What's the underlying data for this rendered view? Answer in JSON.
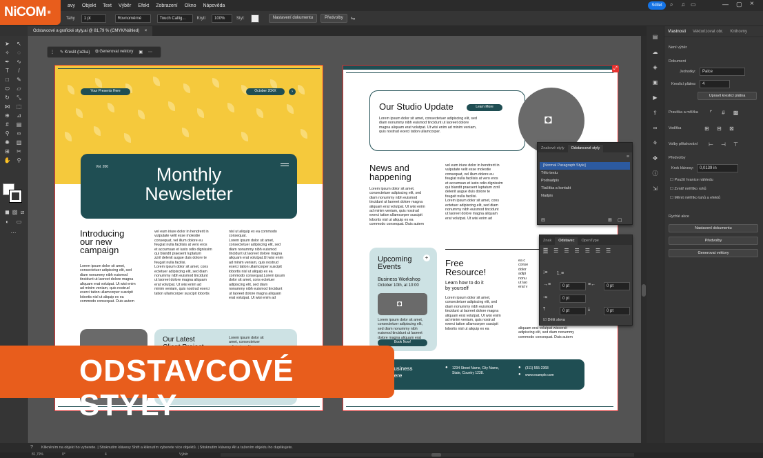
{
  "menu": [
    "avy",
    "Objekt",
    "Text",
    "Výběr",
    "Efekt",
    "Zobrazení",
    "Okno",
    "Nápověda"
  ],
  "share_label": "Sdílet",
  "logo": {
    "text": "NiCOM",
    "sub": ""
  },
  "control": {
    "stroke_label": "Tahy",
    "stroke_value": "1 pt",
    "profile": "Rovnoměrné",
    "brush": "Touch Callig...",
    "opacity_label": "Krytí",
    "opacity_value": "100%",
    "style_label": "Styl:",
    "doc_settings": "Nastavení dokumentu",
    "prefs": "Předvolby"
  },
  "tab": {
    "title": "Odstavcové a grafické styly.ai @ 81,79 % (CMYK/Náhled)",
    "close": "×"
  },
  "context": {
    "draw": "Kreslit (tužka)",
    "generate": "Generovat vektory"
  },
  "properties": {
    "tabs": [
      "Vlastnosti",
      "Vektorizovat obr.",
      "Knihovny"
    ],
    "no_selection": "Není výběr",
    "document": "Dokument",
    "units_label": "Jednotky:",
    "units_value": "Palce",
    "artboard_label": "Kreslicí plátno:",
    "artboard_value": "4",
    "edit_artboards": "Upravit kreslicí plátna",
    "rulers": "Pravítka a mřížka",
    "guides": "Vodítka",
    "snap": "Volby přitahování",
    "preferences": "Předvolby",
    "key_inc_label": "Krok klávesy:",
    "key_inc_value": "0,0139 in",
    "cb1": "Použít hranice náhledu",
    "cb2": "Zvnitř měřítko rohů",
    "cb3": "Měnit měřítko tahů a efektů",
    "quick": "Rychlé akce",
    "qa1": "Nastavení dokumentu",
    "qa2": "Předvolby",
    "qa3": "Generovat vektory"
  },
  "paragraph_styles": {
    "tabs": [
      "Znakové styly",
      "Odstavcové styly"
    ],
    "items": [
      "[Normal Paragraph Style]",
      "Tělo textu",
      "Podnadpis",
      "Tlačítka a kontakt",
      "Nadpis"
    ]
  },
  "paragraph_panel": {
    "tabs": [
      "Znak",
      "Odstavec",
      "OpenType"
    ],
    "f1": "0 pt",
    "f2": "0 pt",
    "f3": "0 pt",
    "f4": "0 pt",
    "f5": "0 pt",
    "f6": "0 pt",
    "hyphen": "Dělit slova"
  },
  "page1": {
    "presents": "Your Presents Here",
    "date": "October 20XX",
    "vol": "Vol. 200",
    "title1": "Monthly",
    "title2": "Newsletter",
    "intro": "Introducing\nour new\ncampaign",
    "c1": "Lorem ipsum dolor sit amet,\nconsectetuer adipiscing elit, sed\ndiam nonummy nibh euismod\ntincidunt ut laoreet dolore magna\naliquam erat volutpat. Ut wisi enim\nad minim veniam, quis nostrud\nexerci tation ullamcorper suscipit\nlobortis nisl ut aliquip ex ea\ncommodo consequat. Duis autem",
    "c2": "vel eum iriure dolor in hendrerit in\nvulputate velit esse molestie\nconsequat, vel illum dolore eu\nfeugiat nulla facilisis at vero eros\net accumsan et iusto odio dignissim\nqui blandit praesent luptatum\nzzril delenit augue duis dolore te\nfeugait nulla facilisi.\nLorem ipsum dolor sit amet, cons\nectetuer adipiscing elit, sed diam\nnonummy nibh euismod tincidunt\nut laoreet dolore magna aliquam\nerat volutpat. Ut wisi enim ad\nminim veniam, quis nostrud exerci\ntation ullamcorper suscipit lobortis",
    "c3": "nisl ut aliquip ex ea commodo\nconsequat.\nLorem ipsum dolor sit amet,\nconsectetuer adipiscing elit, sed\ndiam nonummy nibh euismod\ntincidunt ut laoreet dolore magna\naliquam erat volutpat.Ut wisi enim\nad minim veniam, quis nostrud\nexerci tation ullamcorper suscipit\nlobortis nisl ut aliquip ex ea\ncommodo consequat.Lorem ipsum\ndolor sit amet, cons ectetuer\nadipiscing elit, sed diam\nnonummy nibh euismod tincidunt\nut laoreet dolore magna aliquam\nerat volutpat. Ut wisi enim ad",
    "latest": "Our Latest\nClient Project",
    "c4": "Lorem ipsum dolor sit\namet, consectetuer\nadipiscing elit"
  },
  "page2": {
    "studio": "Our Studio Update",
    "learn": "Learn More",
    "studio_txt": "Lorem ipsum dolor sit amet, consectetuer adipiscing elit, sed\ndiam nonummy nibh euismod tincidunt ut laoreet dolore\nmagna aliquam erat volutpat. Ut wisi enim ad minim veniam,\nquis nostrud exerci tation ullamcorper.",
    "news": "News and\nhappening",
    "n1": "Lorem ipsum dolor sit amet,\nconsectetuer adipiscing elit, sed\ndiam nonummy nibh euismod\ntincidunt ut laoreet dolore magna\naliquam erat volutpat. Ut wisi enim\nad minim veniam, quis nostrud\nexerci tation ullamcorper suscipit\nlobortis nisl ut aliquip ex ea\ncommodo consequat. Duis autem",
    "n2": "vel eum iriure dolor in hendrerit in\nvulputate velit esse molestie\nconsequat, vel illum dolore eu\nfeugiat nulla facilisis at vero eros\net accumsan et iusto odio dignissim\nqui blandit praesent luptatum zzril\ndelenit augue duis dolore te\nfeugait nulla facilisi.\nLorem ipsum dolor sit amet, cons\nectetuer adipiscing elit, sed diam\nnonummy nibh euismod tincidunt\nut laoreet dolore magna aliquam\nerat volutpat. Ut wisi enim ad",
    "upcoming": "Upcoming\nEvents",
    "workshop": "Business Workshop",
    "wdate": "October 10th, at 10:00",
    "u_txt": "Lorem ipsum dolor sit amet,\nconsectetuer adipiscing elit,\nsed diam nonummy nibh\neuismod tincidunt ut laoreet\ndolore magna aliquam erat\nvolutpat.",
    "book": "Book Now!",
    "free": "Free\nResource!",
    "howto": "Learn how to do it\nby yourself",
    "f_txt": "Lorem ipsum dolor sit amet,\nconsectetuer adipiscing elit, sed\ndiam nonummy nibh euismod\ntincidunt ut laoreet dolore magna\naliquam erat volutpat. Ut wisi enim\nad minim veniam, quis nostrud\nexerci tation ullamcorper suscipit\nlobortis nisl ut aliquip ex ea",
    "f_txt2": "ea c\nconse\ndolor\nadipi\nnonu\nut lao\nerat v",
    "f_txt3": "aliquam erat volutpat wissersit\nadipiscing elit, sed diam nonummy\ncommodo consequat. Duis autem",
    "business": "Business\nHere",
    "address": "1234 Street Name, City Name,\nState, Country 1238.",
    "phone": "(311) 555-2368",
    "web": "www.example.com"
  },
  "banner": "ODSTAVCOVÉ STYLY",
  "status": {
    "hint": "Klikněním na objekt ho vyberete.  |  Stisknutím klávesy Shift a kliknutím vyberete více objektů.  |  Stisknutím klávesy Alt a tažením objektu ho duplikujete.",
    "zoom": "81,79%",
    "angle": "0°",
    "page": "4",
    "mode": "Výběr"
  }
}
